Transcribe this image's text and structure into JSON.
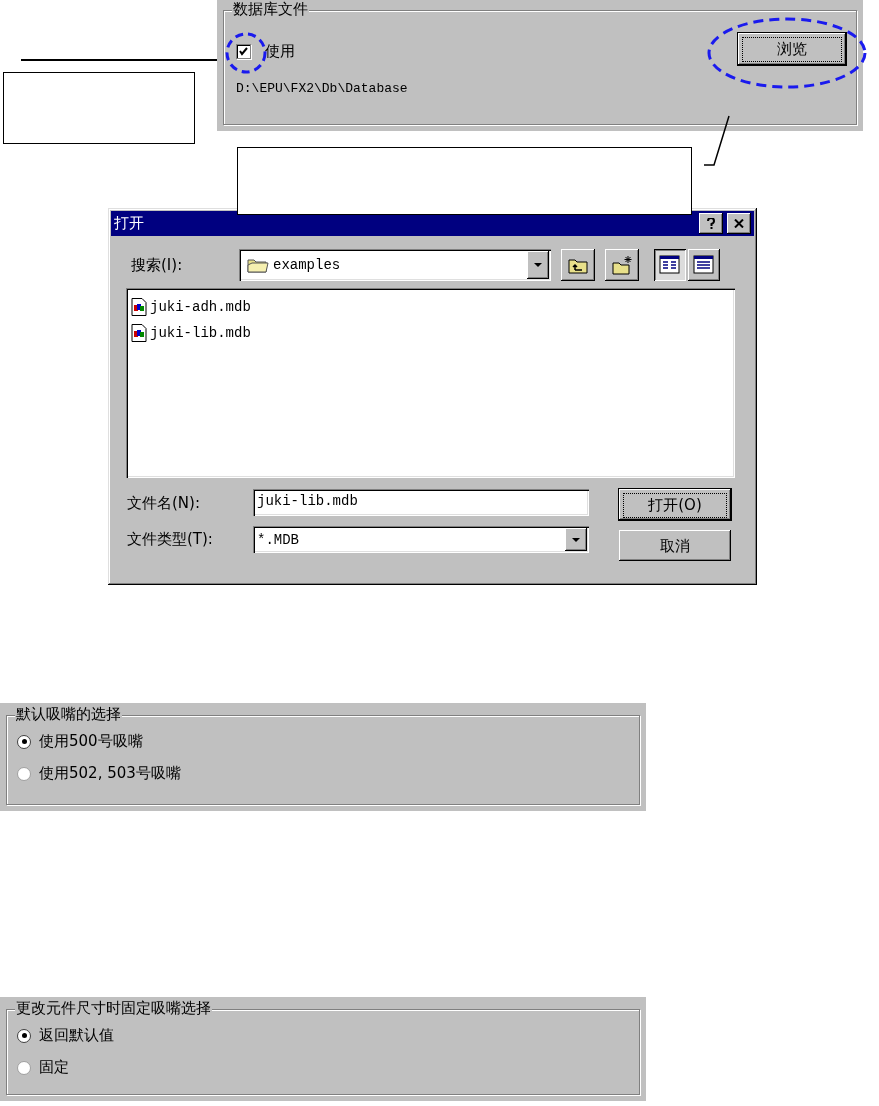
{
  "database_panel": {
    "title": "数据库文件",
    "use_checkbox": {
      "label": "使用",
      "checked": true
    },
    "path": "D:\\EPU\\FX2\\Db\\Database",
    "browse_button": "浏览"
  },
  "open_dialog": {
    "title": "打开",
    "look_in": {
      "label": "搜索(I):",
      "value": "examples"
    },
    "files": [
      {
        "name": "juki-adh.mdb"
      },
      {
        "name": "juki-lib.mdb"
      }
    ],
    "file_name": {
      "label": "文件名(N):",
      "value": "juki-lib.mdb"
    },
    "file_type": {
      "label": "文件类型(T):",
      "value": "*.MDB"
    },
    "buttons": [
      {
        "label": "打开(O)",
        "default": true
      },
      {
        "label": "取消",
        "default": false
      }
    ]
  },
  "nozzle_panels": [
    {
      "title": "默认吸嘴的选择",
      "options": [
        {
          "label": "使用500号吸嘴",
          "selected": true
        },
        {
          "label": "使用502, 503号吸嘴",
          "selected": false
        }
      ]
    },
    {
      "title": "更改元件尺寸时固定吸嘴选择",
      "options": [
        {
          "label": "返回默认值",
          "selected": true
        },
        {
          "label": "固定",
          "selected": false
        }
      ]
    }
  ]
}
